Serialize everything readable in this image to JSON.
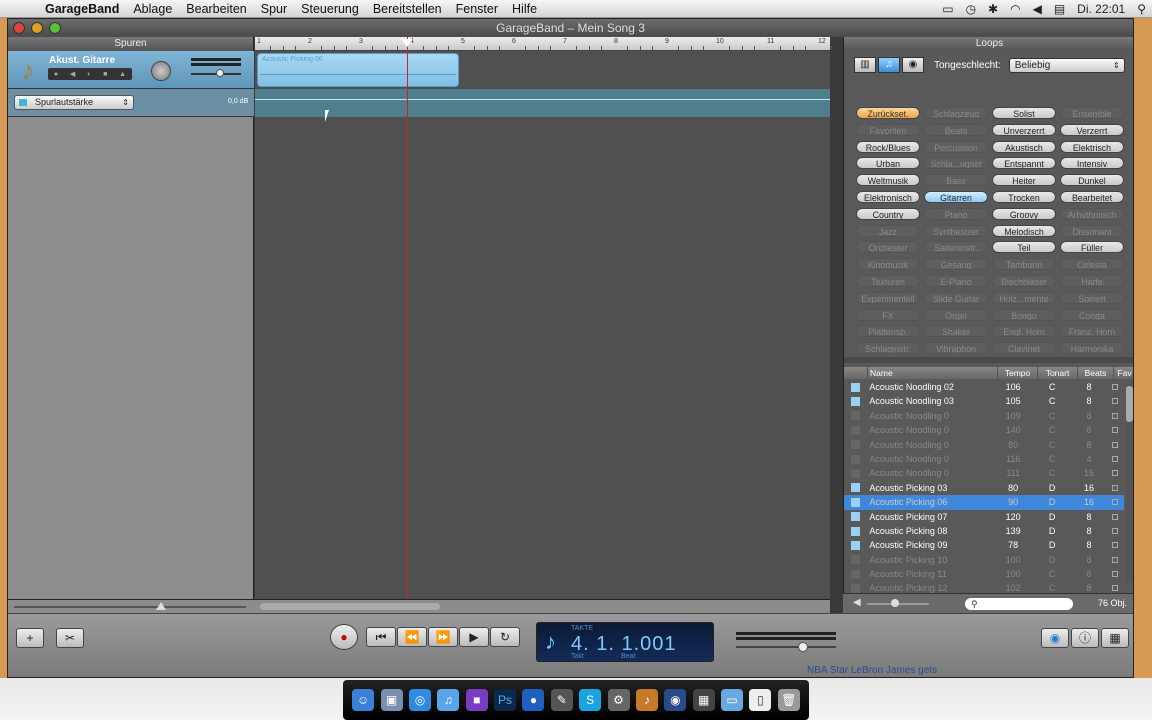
{
  "menubar": {
    "app": "GarageBand",
    "items": [
      "Ablage",
      "Bearbeiten",
      "Spur",
      "Steuerung",
      "Bereitstellen",
      "Fenster",
      "Hilfe"
    ],
    "clock": "Di. 22:01"
  },
  "window": {
    "title": "GarageBand – Mein Song 3"
  },
  "tracks_panel": {
    "header": "Spuren",
    "track": {
      "name": "Akust. Gitarre",
      "region_name": "Acoustic Picking 06"
    },
    "automation": {
      "selected": "Spurlautstärke",
      "db_label": "0,0 dB"
    }
  },
  "ruler": {
    "ticks": [
      "1",
      "2",
      "3",
      "4",
      "5",
      "6",
      "7",
      "8",
      "9",
      "10",
      "11",
      "12"
    ]
  },
  "loops": {
    "header": "Loops",
    "scale_label": "Tongeschlecht:",
    "scale_value": "Beliebig",
    "keywords": [
      {
        "label": "Zurückset.",
        "state": "highlight"
      },
      {
        "label": "Schlagzeug",
        "state": "disabled"
      },
      {
        "label": "Solist",
        "state": "normal"
      },
      {
        "label": "Ensemble",
        "state": "disabled"
      },
      {
        "label": "Favoriten",
        "state": "disabled"
      },
      {
        "label": "Beats",
        "state": "disabled"
      },
      {
        "label": "Unverzerrt",
        "state": "normal"
      },
      {
        "label": "Verzerrt",
        "state": "normal"
      },
      {
        "label": "Rock/Blues",
        "state": "normal"
      },
      {
        "label": "Percussion",
        "state": "disabled"
      },
      {
        "label": "Akustisch",
        "state": "normal"
      },
      {
        "label": "Elektrisch",
        "state": "normal"
      },
      {
        "label": "Urban",
        "state": "normal"
      },
      {
        "label": "Schla...ugset",
        "state": "disabled"
      },
      {
        "label": "Entspannt",
        "state": "normal"
      },
      {
        "label": "Intensiv",
        "state": "normal"
      },
      {
        "label": "Weltmusik",
        "state": "normal"
      },
      {
        "label": "Bass",
        "state": "disabled"
      },
      {
        "label": "Heiter",
        "state": "normal"
      },
      {
        "label": "Dunkel",
        "state": "normal"
      },
      {
        "label": "Elektronisch",
        "state": "normal"
      },
      {
        "label": "Gitarren",
        "state": "selected"
      },
      {
        "label": "Trocken",
        "state": "normal"
      },
      {
        "label": "Bearbeitet",
        "state": "normal"
      },
      {
        "label": "Country",
        "state": "normal"
      },
      {
        "label": "Piano",
        "state": "disabled"
      },
      {
        "label": "Groovy",
        "state": "normal"
      },
      {
        "label": "Arhythmisch",
        "state": "disabled"
      },
      {
        "label": "Jazz",
        "state": "disabled"
      },
      {
        "label": "Synthesizer",
        "state": "disabled"
      },
      {
        "label": "Melodisch",
        "state": "normal"
      },
      {
        "label": "Dissonant",
        "state": "disabled"
      },
      {
        "label": "Orchester",
        "state": "disabled"
      },
      {
        "label": "Saiteninstr.",
        "state": "disabled"
      },
      {
        "label": "Teil",
        "state": "normal"
      },
      {
        "label": "Füller",
        "state": "normal"
      },
      {
        "label": "Kinomusik",
        "state": "disabled"
      },
      {
        "label": "Gesang",
        "state": "disabled"
      },
      {
        "label": "Tamburin",
        "state": "disabled"
      },
      {
        "label": "Celesta",
        "state": "disabled"
      },
      {
        "label": "Texturen",
        "state": "disabled"
      },
      {
        "label": "E-Piano",
        "state": "disabled"
      },
      {
        "label": "Blechbläser",
        "state": "disabled"
      },
      {
        "label": "Harfe",
        "state": "disabled"
      },
      {
        "label": "Experimentell",
        "state": "disabled"
      },
      {
        "label": "Slide Guitar",
        "state": "disabled"
      },
      {
        "label": "Holz...mente",
        "state": "disabled"
      },
      {
        "label": "Spinett",
        "state": "disabled"
      },
      {
        "label": "FX",
        "state": "disabled"
      },
      {
        "label": "Orgel",
        "state": "disabled"
      },
      {
        "label": "Bongo",
        "state": "disabled"
      },
      {
        "label": "Conga",
        "state": "disabled"
      },
      {
        "label": "Plattensp.",
        "state": "disabled"
      },
      {
        "label": "Shaker",
        "state": "disabled"
      },
      {
        "label": "Engl. Horn",
        "state": "disabled"
      },
      {
        "label": "Franz. Horn",
        "state": "disabled"
      },
      {
        "label": "Schlaginstr.",
        "state": "disabled"
      },
      {
        "label": "Vibraphon",
        "state": "disabled"
      },
      {
        "label": "Clavinet",
        "state": "disabled"
      },
      {
        "label": "Harmonika",
        "state": "disabled"
      }
    ],
    "columns": [
      "Name",
      "Tempo",
      "Tonart",
      "Beats",
      "Fav"
    ],
    "rows": [
      {
        "name": "Acoustic Noodling 02",
        "tempo": "106",
        "key": "C",
        "beats": "8",
        "state": "normal"
      },
      {
        "name": "Acoustic Noodling 03",
        "tempo": "105",
        "key": "C",
        "beats": "8",
        "state": "normal"
      },
      {
        "name": "Acoustic Noodling 0",
        "tempo": "109",
        "key": "C",
        "beats": "8",
        "state": "disabled"
      },
      {
        "name": "Acoustic Noodling 0",
        "tempo": "140",
        "key": "C",
        "beats": "8",
        "state": "disabled"
      },
      {
        "name": "Acoustic Noodling 0",
        "tempo": "80",
        "key": "C",
        "beats": "8",
        "state": "disabled"
      },
      {
        "name": "Acoustic Noodling 0",
        "tempo": "116",
        "key": "C",
        "beats": "4",
        "state": "disabled"
      },
      {
        "name": "Acoustic Noodling 0",
        "tempo": "111",
        "key": "C",
        "beats": "16",
        "state": "disabled"
      },
      {
        "name": "Acoustic Picking 03",
        "tempo": "80",
        "key": "D",
        "beats": "16",
        "state": "normal"
      },
      {
        "name": "Acoustic Picking 06",
        "tempo": "90",
        "key": "D",
        "beats": "16",
        "state": "selected"
      },
      {
        "name": "Acoustic Picking 07",
        "tempo": "120",
        "key": "D",
        "beats": "8",
        "state": "normal"
      },
      {
        "name": "Acoustic Picking 08",
        "tempo": "139",
        "key": "D",
        "beats": "8",
        "state": "normal"
      },
      {
        "name": "Acoustic Picking 09",
        "tempo": "78",
        "key": "D",
        "beats": "8",
        "state": "normal"
      },
      {
        "name": "Acoustic Picking 10",
        "tempo": "100",
        "key": "D",
        "beats": "8",
        "state": "disabled"
      },
      {
        "name": "Acoustic Picking 11",
        "tempo": "100",
        "key": "C",
        "beats": "8",
        "state": "disabled"
      },
      {
        "name": "Acoustic Picking 12",
        "tempo": "102",
        "key": "C",
        "beats": "8",
        "state": "disabled"
      }
    ],
    "count": "76 Obj."
  },
  "lcd": {
    "label_top": "TAKTE",
    "value": "4. 1. 1.001",
    "label_takt": "Takt",
    "label_beat": "Beat"
  },
  "background_text": "NBA Star LeBron James gets"
}
